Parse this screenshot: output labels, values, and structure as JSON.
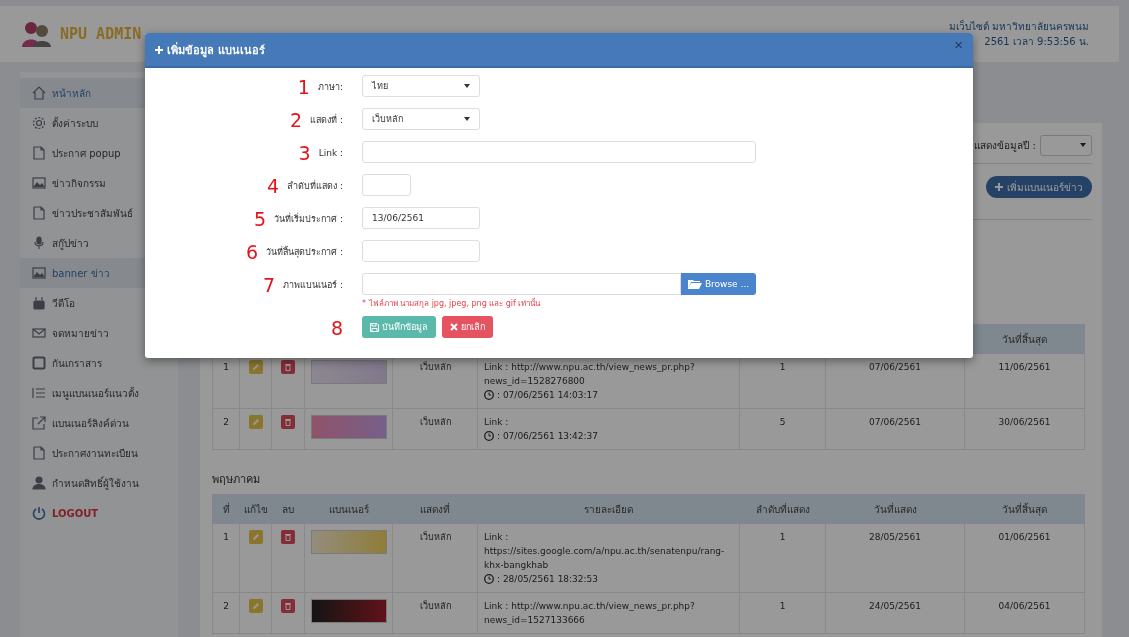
{
  "brand": {
    "name": "NPU ADMIN"
  },
  "header_info": [
    "มเว็บไซต์ มหาวิทยาลัยนครพนม",
    "2561  เวลา 9:53:56  น."
  ],
  "sidebar": {
    "items": [
      {
        "label": "หน้าหลัก",
        "selected": true,
        "kind": "link"
      },
      {
        "label": "ตั้งค่าระบบ",
        "selected": false,
        "kind": "link"
      },
      {
        "label": "ประกาศ popup",
        "selected": false,
        "kind": "link"
      },
      {
        "label": "ข่าวกิจกรรม",
        "selected": false,
        "kind": "link"
      },
      {
        "label": "ข่าวประชาสัมพันธ์",
        "selected": false,
        "kind": "link"
      },
      {
        "label": "สกู๊ปข่าว",
        "selected": false,
        "kind": "link"
      },
      {
        "label": "banner ข่าว",
        "selected": true,
        "kind": "link"
      },
      {
        "label": "วีดีโอ",
        "selected": false,
        "kind": "link"
      },
      {
        "label": "จดหมายข่าว",
        "selected": false,
        "kind": "link"
      },
      {
        "label": "กันเกราสาร",
        "selected": false,
        "kind": "link"
      },
      {
        "label": "เมนูแบนเนอร์แนวตั้ง",
        "selected": false,
        "kind": "link"
      },
      {
        "label": "แบนเนอร์ลิงค์ด่วน",
        "selected": false,
        "kind": "link"
      },
      {
        "label": "ประกาศงานทะเบียน",
        "selected": false,
        "kind": "link"
      },
      {
        "label": "กำหนดสิทธิ์ผู้ใช้งาน",
        "selected": false,
        "kind": "link"
      },
      {
        "label": "LOGOUT",
        "selected": false,
        "kind": "logout"
      }
    ]
  },
  "toolbar": {
    "year_label": "แสดงข้อมูลปี :",
    "add_button": "เพิ่มแบนเนอร์ข่าว"
  },
  "sections": [
    {
      "last_heading": "วันที่สิ้นสุด",
      "rows": [
        {
          "no": "1",
          "display": "เว็บหลัก",
          "link": "Link : http://www.npu.ac.th/view_news_pr.php? news_id=1528276800",
          "time": ": 07/06/2561 14:03:17",
          "order": "1",
          "start": "07/06/2561",
          "end": "11/06/2561"
        },
        {
          "no": "2",
          "display": "เว็บหลัก",
          "link": "Link :",
          "time": ": 07/06/2561 13:42:37",
          "order": "5",
          "start": "07/06/2561",
          "end": "30/06/2561"
        }
      ]
    },
    {
      "heading": "พฤษภาคม",
      "columns": [
        "ที่",
        "แก้ไข",
        "ลบ",
        "แบนเนอร์",
        "แสดงที่",
        "รายละเอียด",
        "ลำดับที่แสดง",
        "วันที่แสดง",
        "วันที่สิ้นสุด"
      ],
      "rows": [
        {
          "no": "1",
          "display": "เว็บหลัก",
          "link": "Link : https://sites.google.com/a/npu.ac.th/senatenpu/rang-khx-bangkhab",
          "time": ": 28/05/2561 18:32:53",
          "order": "1",
          "start": "28/05/2561",
          "end": "01/06/2561"
        },
        {
          "no": "2",
          "display": "เว็บหลัก",
          "link": "Link : http://www.npu.ac.th/view_news_pr.php? news_id=1527133666",
          "order": "1",
          "start": "24/05/2561",
          "end": "04/06/2561"
        }
      ]
    }
  ],
  "modal": {
    "title": "เพิ่มข้อมูล แบนเนอร์",
    "close": "×",
    "fields": [
      {
        "marker": "1",
        "label": "ภาษา:",
        "kind": "select",
        "value": "ไทย"
      },
      {
        "marker": "2",
        "label": "แสดงที่ :",
        "kind": "select",
        "value": "เว็บหลัก"
      },
      {
        "marker": "3",
        "label": "Link :",
        "kind": "text"
      },
      {
        "marker": "4",
        "label": "ลำดับที่แสดง :",
        "kind": "short"
      },
      {
        "marker": "5",
        "label": "วันที่เริ่มประกาศ :",
        "kind": "date",
        "value": "13/06/2561"
      },
      {
        "marker": "6",
        "label": "วันที่สิ้นสุดประกาศ :",
        "kind": "date"
      },
      {
        "marker": "7",
        "label": "ภาพแบนเนอร์ :",
        "kind": "file",
        "button": "Browse ...",
        "hint": "* ไฟล์ภาพ นามสกุล jpg, jpeg, png และ gif เท่านั้น"
      }
    ],
    "actions": {
      "marker": "8",
      "save": "บันทึกข้อมูล",
      "cancel": "ยกเลิก"
    }
  }
}
